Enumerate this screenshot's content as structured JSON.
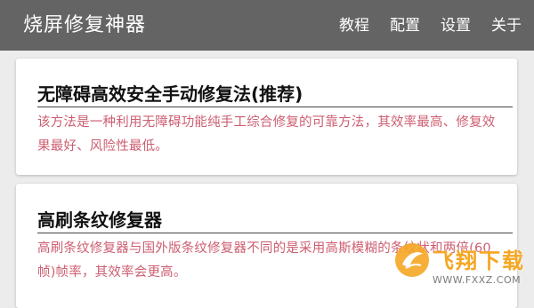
{
  "appbar": {
    "title": "烧屏修复神器",
    "menu": [
      {
        "label": "教程"
      },
      {
        "label": "配置"
      },
      {
        "label": "设置"
      },
      {
        "label": "关于"
      }
    ]
  },
  "cards": [
    {
      "title": "无障碍高效安全手动修复法(推荐)",
      "description": "该方法是一种利用无障碍功能纯手工综合修复的可靠方法，其效率最高、修复效果最好、风险性最低。"
    },
    {
      "title": "高刷条纹修复器",
      "description": "高刷条纹修复器与国外版条纹修复器不同的是采用高斯模糊的条纹状和两倍(60帧)帧率，其效率会更高。"
    }
  ],
  "watermark": {
    "brand": "飞翔下载",
    "url": "WWW.FXXZ.COM"
  },
  "colors": {
    "appbar": "#646464",
    "background": "#ececec",
    "card": "#ffffff",
    "description_text": "#cd5e70"
  }
}
